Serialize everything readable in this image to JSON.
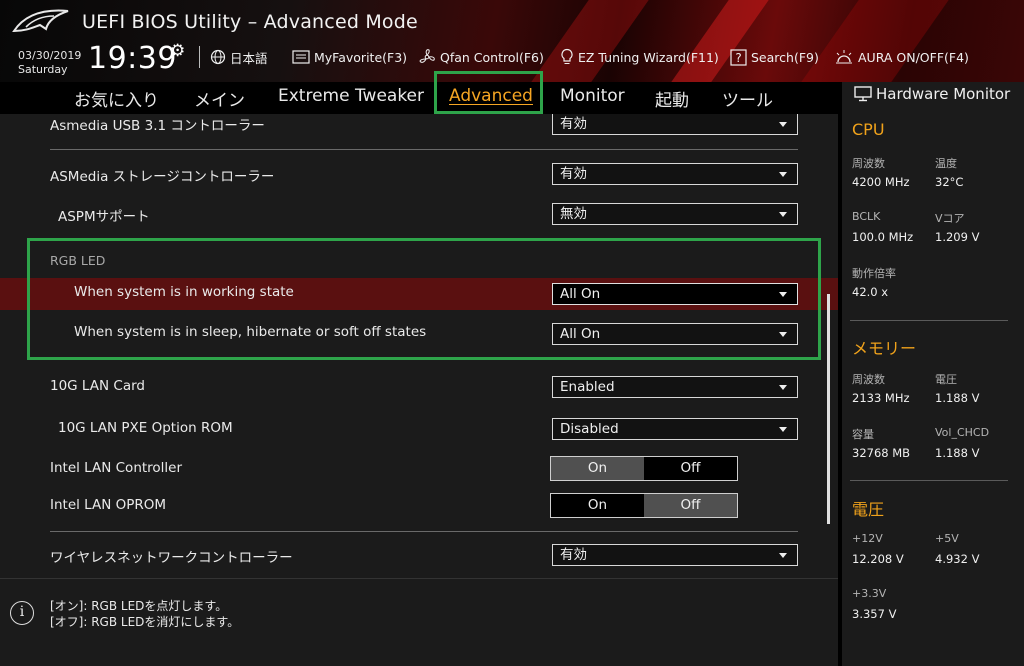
{
  "header": {
    "title": "UEFI BIOS Utility – Advanced Mode",
    "date": "03/30/2019",
    "weekday": "Saturday",
    "time": "19:39",
    "buttons": {
      "language": "日本語",
      "myfavorite": "MyFavorite(F3)",
      "qfan": "Qfan Control(F6)",
      "ez_tuning": "EZ Tuning Wizard(F11)",
      "search": "Search(F9)",
      "aura": "AURA ON/OFF(F4)"
    }
  },
  "tabs": {
    "favorites": "お気に入り",
    "main": "メイン",
    "extreme_tweaker": "Extreme Tweaker",
    "advanced": "Advanced",
    "monitor": "Monitor",
    "boot": "起動",
    "tool": "ツール"
  },
  "settings": {
    "asmedia_usb": {
      "label": "Asmedia USB 3.1 コントローラー",
      "value": "有効"
    },
    "asmedia_storage": {
      "label": "ASMedia ストレージコントローラー",
      "value": "有効"
    },
    "aspm": {
      "label": "ASPMサポート",
      "value": "無効"
    },
    "rgb_section": "RGB LED",
    "rgb_working": {
      "label": "When system is in working state",
      "value": "All On"
    },
    "rgb_sleep": {
      "label": "When system is in sleep, hibernate or soft off states",
      "value": "All On"
    },
    "lan10g": {
      "label": "10G LAN Card",
      "value": "Enabled"
    },
    "lan10g_pxe": {
      "label": "10G LAN PXE Option ROM",
      "value": "Disabled"
    },
    "intel_lan": {
      "label": "Intel LAN Controller",
      "on": "On",
      "off": "Off",
      "selected": "On"
    },
    "intel_oprom": {
      "label": "Intel LAN OPROM",
      "on": "On",
      "off": "Off",
      "selected": "Off"
    },
    "wireless": {
      "label": "ワイヤレスネットワークコントローラー",
      "value": "有効"
    }
  },
  "help": {
    "line1": "[オン]: RGB LEDを点灯します。",
    "line2": "[オフ]: RGB LEDを消灯にします。"
  },
  "hwmon": {
    "title": "Hardware Monitor",
    "cpu": {
      "heading": "CPU",
      "freq_label": "周波数",
      "freq": "4200 MHz",
      "temp_label": "温度",
      "temp": "32°C",
      "bclk_label": "BCLK",
      "bclk": "100.0 MHz",
      "vcore_label": "Vコア",
      "vcore": "1.209 V",
      "ratio_label": "動作倍率",
      "ratio": "42.0 x"
    },
    "memory": {
      "heading": "メモリー",
      "freq_label": "周波数",
      "freq": "2133 MHz",
      "volt_label": "電圧",
      "volt": "1.188 V",
      "cap_label": "容量",
      "cap": "32768 MB",
      "vol_chcd_label": "Vol_CHCD",
      "vol_chcd": "1.188 V"
    },
    "voltage": {
      "heading": "電圧",
      "v12_label": "+12V",
      "v12": "12.208 V",
      "v5_label": "+5V",
      "v5": "4.932 V",
      "v33_label": "+3.3V",
      "v33": "3.357 V"
    }
  },
  "colors": {
    "accent": "#f6a623",
    "highlight_row": "#5a1010",
    "annotation": "#2ea44a"
  }
}
